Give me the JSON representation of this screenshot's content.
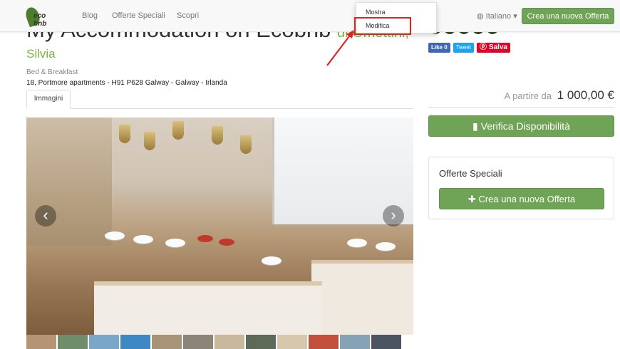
{
  "navbar": {
    "logo_text": "eco bnb",
    "links": [
      "Blog",
      "Offerte Speciali",
      "Scopri"
    ],
    "language": "Italiano",
    "create_offer_label": "Crea una nuova Offerta"
  },
  "dropdown": {
    "items": [
      "Mostra",
      "Modifica"
    ],
    "highlighted": "Modifica"
  },
  "listing": {
    "title": "My Accommodation on Ecobnb",
    "by_prefix": "di Omettini,",
    "host": "Silvia",
    "type": "Bed & Breakfast",
    "address": "18, Portmore apartments - H91 P628 Galway - Galway - Irlanda",
    "tab": "Immagini"
  },
  "social": {
    "like": "Like 0",
    "tweet": "Tweet",
    "pin": "Salva"
  },
  "pricing": {
    "prefix": "A partire da",
    "amount": "1 000,00 €",
    "verify_label": "Verifica Disponibilità"
  },
  "special_offers": {
    "title": "Offerte Speciali",
    "create_label": "Crea una nuova Offerta"
  },
  "colors": {
    "brand_green": "#6fa356",
    "highlight_red": "#e2231a"
  }
}
